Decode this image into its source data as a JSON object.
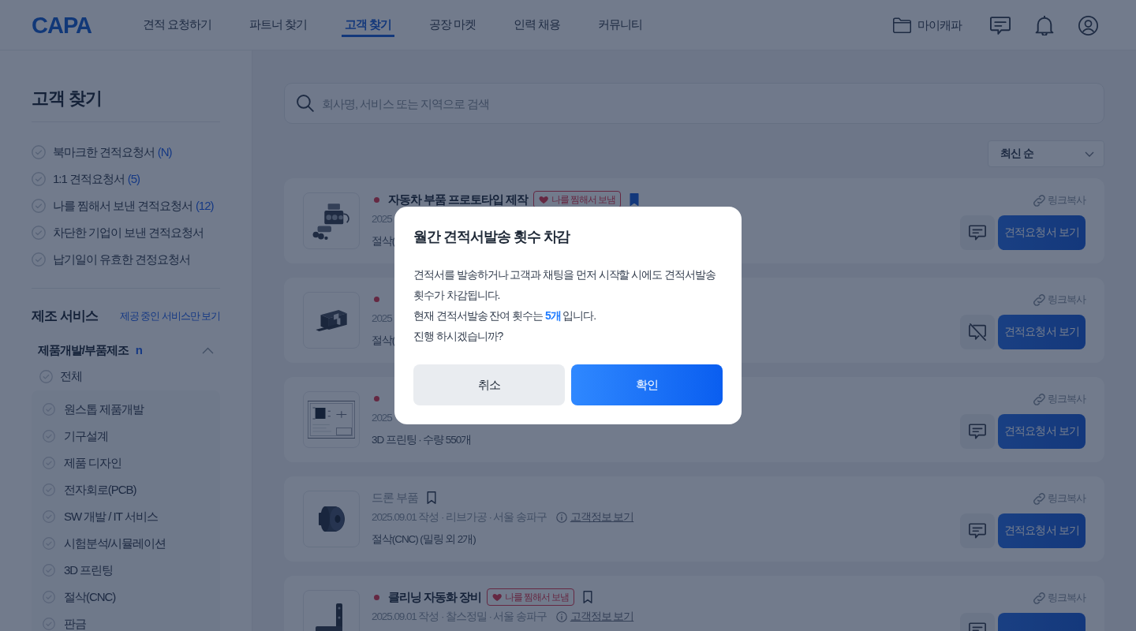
{
  "header": {
    "logo": "CAPA",
    "nav": [
      {
        "label": "견적 요청하기",
        "selected": false
      },
      {
        "label": "파트너 찾기",
        "selected": false
      },
      {
        "label": "고객 찾기",
        "selected": true
      },
      {
        "label": "공장 마켓",
        "selected": false
      },
      {
        "label": "인력 채용",
        "selected": false
      },
      {
        "label": "커뮤니티",
        "selected": false
      }
    ],
    "my_link": "마이캐파"
  },
  "sidebar": {
    "title": "고객 찾기",
    "filters": [
      {
        "label": "북마크한 견적요청서",
        "count": "(N)",
        "checked": false
      },
      {
        "label": "1:1 견적요청서",
        "count": "(5)",
        "checked": false
      },
      {
        "label": "나를 찜해서 보낸 견적요청서",
        "count": "(12)",
        "checked": false
      },
      {
        "label": "차단한 기업이 보낸 견적요청서",
        "checked": false
      },
      {
        "label": "납기일이 유효한 견정요청서",
        "checked": false
      }
    ],
    "section": {
      "title": "제조 서비스",
      "link": "제공 중인 서비스만 보기"
    },
    "category": {
      "title": "제품개발/부품제조",
      "badge": "n",
      "expanded": true,
      "all": {
        "label": "전체",
        "checked": false
      },
      "items": [
        {
          "label": "원스톱 제품개발",
          "checked": false
        },
        {
          "label": "기구설계",
          "checked": false
        },
        {
          "label": "제품 디자인",
          "checked": false
        },
        {
          "label": "전자회로(PCB)",
          "checked": false
        },
        {
          "label": "SW 개발 / IT 서비스",
          "checked": false
        },
        {
          "label": "시험분석/시뮬레이션",
          "checked": false
        },
        {
          "label": "3D 프린팅",
          "checked": false
        },
        {
          "label": "절삭(CNC)",
          "checked": false
        },
        {
          "label": "판금",
          "checked": false
        }
      ]
    }
  },
  "search": {
    "placeholder": "회사명, 서비스 또는 지역으로 검색"
  },
  "sort": {
    "value": "최신 순"
  },
  "cards": [
    {
      "unread": true,
      "title": "자동차 부품 프로토타입 제작",
      "tag": "나를 찜해서 보냄",
      "bookmarked": true,
      "meta": "2025",
      "service": "절삭(",
      "copy_link": "링크복사",
      "chat_enabled": true,
      "view_button": "견적요청서 보기"
    },
    {
      "unread": true,
      "meta": "2025",
      "service": "절삭(",
      "copy_link": "링크복사",
      "chat_enabled": false,
      "view_button": "견적요청서 보기"
    },
    {
      "unread": true,
      "meta": "2025",
      "service": "3D 프린팅 · 수량 550개",
      "copy_link": "링크복사",
      "chat_enabled": true,
      "view_button": "견적요청서 보기"
    },
    {
      "unread": false,
      "title": "드론 부품",
      "bookmarked": false,
      "meta": "2025.09.01 작성 · 리브가공 · 서울 송파구",
      "info_link": "고객정보 보기",
      "service": "절삭(CNC) (밀링 외 2개)",
      "copy_link": "링크복사",
      "chat_enabled": true,
      "view_button": "견적요청서 보기"
    },
    {
      "unread": true,
      "title": "클리닝 자동화 장비",
      "tag": "나를 찜해서 보냄",
      "bookmarked": false,
      "meta": "2025.09.01 작성 · 찰스정밀 · 서울 송파구",
      "info_link": "고객정보 보기",
      "copy_link": "링크복사",
      "chat_enabled": true
    }
  ],
  "modal": {
    "title": "월간 견적서발송 횟수 차감",
    "paragraphs": [
      "견적서를 발송하거나 고객과 채팅을 먼저 시작할 시에도 견적서발송 횟수가 차감됩니다.",
      "현재 견적서발송 잔여 횟수는 **5개** 입니다.",
      "진행 하시겠습니까?"
    ],
    "buttons": [
      {
        "label": "취소",
        "kind": "secondary"
      },
      {
        "label": "확인",
        "kind": "primary"
      }
    ]
  }
}
